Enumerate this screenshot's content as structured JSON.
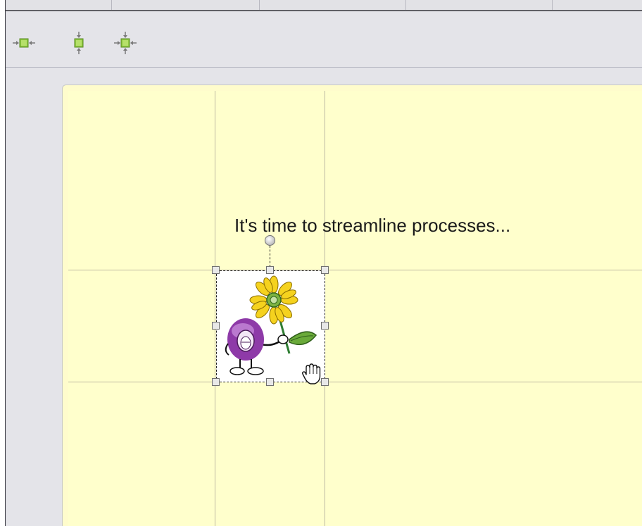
{
  "toolbar": {
    "buttons": [
      {
        "icon": "align-horizontal-center-icon"
      },
      {
        "icon": "align-vertical-center-icon"
      },
      {
        "icon": "align-both-center-icon"
      }
    ]
  },
  "slide": {
    "caption": "It's time to streamline processes...",
    "image": {
      "name": "purple-creature-with-sunflower",
      "selected": true
    }
  },
  "colors": {
    "canvas": "#ffffcc",
    "guide_lines": "#bdb9a2",
    "toolbar": "#e4e4e9",
    "icon_green": "#8cc63f"
  }
}
